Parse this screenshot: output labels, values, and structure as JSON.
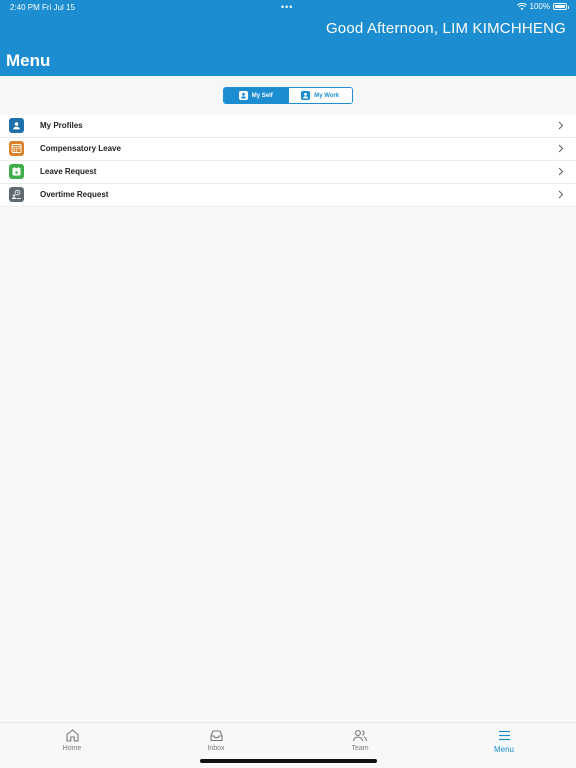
{
  "status_bar": {
    "time": "2:40 PM",
    "date": "Fri Jul 15",
    "dots": "•••",
    "battery": "100%"
  },
  "header": {
    "greeting": "Good Afternoon, LIM KIMCHHENG",
    "title": "Menu",
    "background_color": "#1b8dd0"
  },
  "segmented": {
    "options": [
      {
        "label": "My Self",
        "icon": "person-icon",
        "selected": true
      },
      {
        "label": "My Work",
        "icon": "person-icon",
        "selected": false
      }
    ]
  },
  "menu": {
    "items": [
      {
        "label": "My Profiles",
        "icon": "profile-icon",
        "icon_color": "#1f6fa8"
      },
      {
        "label": "Compensatory Leave",
        "icon": "calendar-grid-icon",
        "icon_color": "#d9822b"
      },
      {
        "label": "Leave Request",
        "icon": "calendar-icon",
        "icon_color": "#3fae4a"
      },
      {
        "label": "Overtime Request",
        "icon": "overtime-clock-icon",
        "icon_color": "#5f6a72"
      }
    ]
  },
  "tab_bar": {
    "tabs": [
      {
        "label": "Home",
        "icon": "home-icon",
        "active": false
      },
      {
        "label": "Inbox",
        "icon": "inbox-icon",
        "active": false
      },
      {
        "label": "Team",
        "icon": "team-icon",
        "active": false
      },
      {
        "label": "Menu",
        "icon": "menu-icon",
        "active": true
      }
    ],
    "active_color": "#1b8dd0"
  }
}
